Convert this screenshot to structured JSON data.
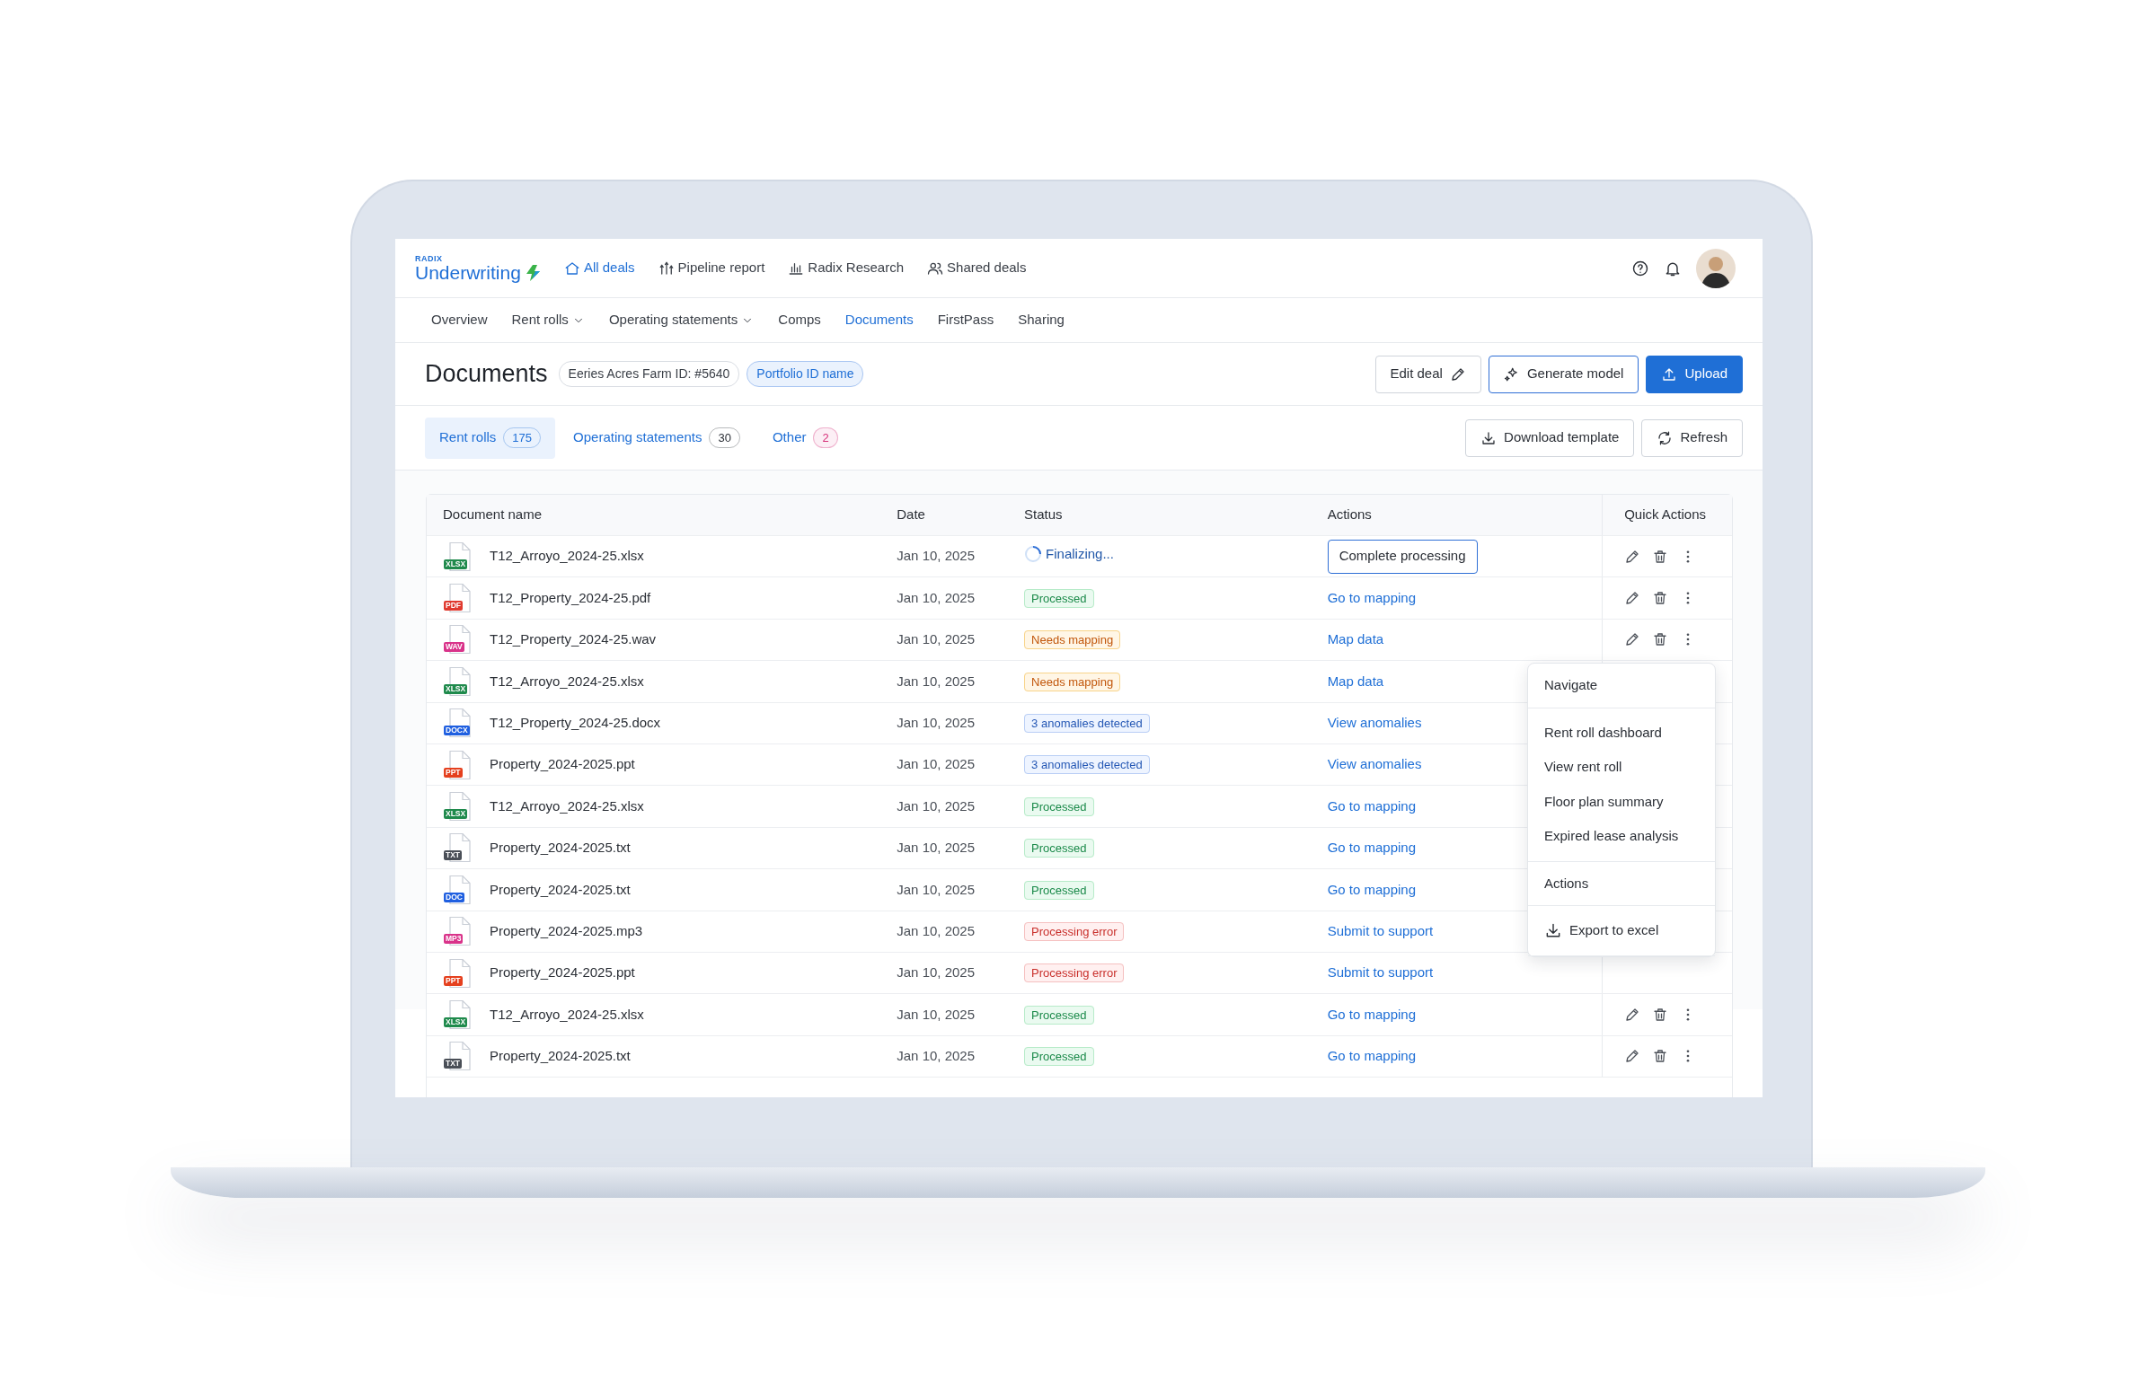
{
  "top_nav": {
    "logo": {
      "small": "RADIX",
      "name": "Underwriting"
    },
    "items": [
      {
        "label": "All deals",
        "selected": true
      },
      {
        "label": "Pipeline report",
        "selected": false
      },
      {
        "label": "Radix Research",
        "selected": false
      },
      {
        "label": "Shared deals",
        "selected": false
      }
    ]
  },
  "sub_nav": [
    {
      "label": "Overview",
      "dropdown": false,
      "selected": false
    },
    {
      "label": "Rent rolls",
      "dropdown": true,
      "selected": false
    },
    {
      "label": "Operating statements",
      "dropdown": true,
      "selected": false
    },
    {
      "label": "Comps",
      "dropdown": false,
      "selected": false
    },
    {
      "label": "Documents",
      "dropdown": false,
      "selected": true
    },
    {
      "label": "FirstPass",
      "dropdown": false,
      "selected": false
    },
    {
      "label": "Sharing",
      "dropdown": false,
      "selected": false
    }
  ],
  "page_header": {
    "title": "Documents",
    "tags": [
      {
        "text": "Eeries Acres Farm ID: #5640",
        "kind": "neutral"
      },
      {
        "text": "Portfolio ID name",
        "kind": "link"
      }
    ],
    "buttons": [
      {
        "label": "Edit deal",
        "kind": "outline"
      },
      {
        "label": "Generate model",
        "kind": "accent"
      },
      {
        "label": "Upload",
        "kind": "primary"
      }
    ]
  },
  "doc_tabs": [
    {
      "label": "Rent rolls",
      "count": "175",
      "selected": true,
      "color": "#1f6fd6"
    },
    {
      "label": "Operating statements",
      "count": "30",
      "selected": false,
      "color": "#2b2f36"
    },
    {
      "label": "Other",
      "count": "2",
      "selected": false,
      "color": "#d6337a"
    }
  ],
  "tab_buttons": [
    {
      "label": "Download template"
    },
    {
      "label": "Refresh"
    }
  ],
  "table": {
    "columns": [
      "Document name",
      "Date",
      "Status",
      "Actions",
      "Quick Actions"
    ],
    "rows": [
      {
        "file_type": "XLSX",
        "color": "#1f8a4c",
        "name": "T12_Arroyo_2024-25.xlsx",
        "date": "Jan 10, 2025",
        "status": {
          "kind": "finalizing",
          "text": "Finalizing..."
        },
        "action": {
          "kind": "button",
          "text": "Complete processing"
        }
      },
      {
        "file_type": "PDF",
        "color": "#e03a2f",
        "name": "T12_Property_2024-25.pdf",
        "date": "Jan 10, 2025",
        "status": {
          "kind": "processed",
          "text": "Processed"
        },
        "action": {
          "kind": "link",
          "text": "Go to mapping"
        }
      },
      {
        "file_type": "WAV",
        "color": "#d9338a",
        "name": "T12_Property_2024-25.wav",
        "date": "Jan 10, 2025",
        "status": {
          "kind": "needs",
          "text": "Needs mapping"
        },
        "action": {
          "kind": "link",
          "text": "Map data"
        }
      },
      {
        "file_type": "XLSX",
        "color": "#1f8a4c",
        "name": "T12_Arroyo_2024-25.xlsx",
        "date": "Jan 10, 2025",
        "status": {
          "kind": "needs",
          "text": "Needs mapping"
        },
        "action": {
          "kind": "link",
          "text": "Map data"
        }
      },
      {
        "file_type": "DOCX",
        "color": "#1f5fe0",
        "name": "T12_Property_2024-25.docx",
        "date": "Jan 10, 2025",
        "status": {
          "kind": "anomalies",
          "text": "3 anomalies detected"
        },
        "action": {
          "kind": "link",
          "text": "View anomalies"
        }
      },
      {
        "file_type": "PPT",
        "color": "#e5401e",
        "name": "Property_2024-2025.ppt",
        "date": "Jan 10, 2025",
        "status": {
          "kind": "anomalies",
          "text": "3 anomalies detected"
        },
        "action": {
          "kind": "link",
          "text": "View anomalies"
        }
      },
      {
        "file_type": "XLSX",
        "color": "#1f8a4c",
        "name": "T12_Arroyo_2024-25.xlsx",
        "date": "Jan 10, 2025",
        "status": {
          "kind": "processed",
          "text": "Processed"
        },
        "action": {
          "kind": "link",
          "text": "Go to mapping"
        }
      },
      {
        "file_type": "TXT",
        "color": "#4a4f57",
        "name": "Property_2024-2025.txt",
        "date": "Jan 10, 2025",
        "status": {
          "kind": "processed",
          "text": "Processed"
        },
        "action": {
          "kind": "link",
          "text": "Go to mapping"
        }
      },
      {
        "file_type": "DOC",
        "color": "#1f5fe0",
        "name": "Property_2024-2025.txt",
        "date": "Jan 10, 2025",
        "status": {
          "kind": "processed",
          "text": "Processed"
        },
        "action": {
          "kind": "link",
          "text": "Go to mapping"
        }
      },
      {
        "file_type": "MP3",
        "color": "#d9338a",
        "name": "Property_2024-2025.mp3",
        "date": "Jan 10, 2025",
        "status": {
          "kind": "error",
          "text": "Processing error"
        },
        "action": {
          "kind": "link",
          "text": "Submit to support"
        }
      },
      {
        "file_type": "PPT",
        "color": "#e5401e",
        "name": "Property_2024-2025.ppt",
        "date": "Jan 10, 2025",
        "status": {
          "kind": "error",
          "text": "Processing error"
        },
        "action": {
          "kind": "link",
          "text": "Submit to support"
        }
      },
      {
        "file_type": "XLSX",
        "color": "#1f8a4c",
        "name": "T12_Arroyo_2024-25.xlsx",
        "date": "Jan 10, 2025",
        "status": {
          "kind": "processed",
          "text": "Processed"
        },
        "action": {
          "kind": "link",
          "text": "Go to mapping"
        }
      },
      {
        "file_type": "TXT",
        "color": "#4a4f57",
        "name": "Property_2024-2025.txt",
        "date": "Jan 10, 2025",
        "status": {
          "kind": "processed",
          "text": "Processed"
        },
        "action": {
          "kind": "link",
          "text": "Go to mapping"
        }
      }
    ]
  },
  "menu": {
    "sections": [
      {
        "heading": "Navigate",
        "items": [
          {
            "label": "Rent roll dashboard",
            "kind": "plain"
          },
          {
            "label": "View rent roll",
            "kind": "plain"
          },
          {
            "label": "Floor plan summary",
            "kind": "plain"
          },
          {
            "label": "Expired lease analysis",
            "kind": "plain"
          }
        ]
      },
      {
        "heading": "Actions",
        "items": [
          {
            "label": "Export to excel",
            "kind": "download"
          }
        ]
      }
    ]
  }
}
